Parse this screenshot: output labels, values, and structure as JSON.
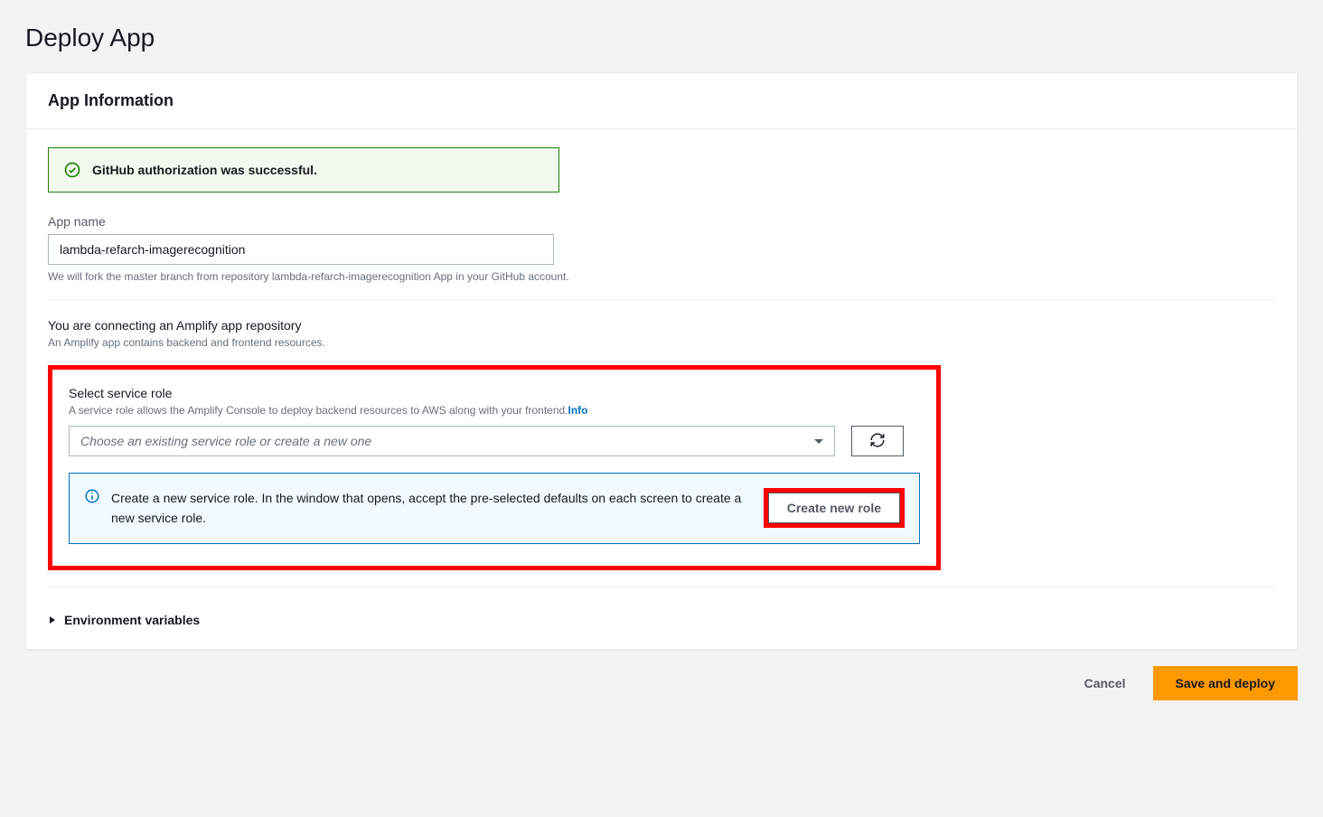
{
  "page": {
    "title": "Deploy App"
  },
  "card": {
    "title": "App Information"
  },
  "alert": {
    "message": "GitHub authorization was successful."
  },
  "appName": {
    "label": "App name",
    "value": "lambda-refarch-imagerecognition",
    "helper": "We will fork the master branch from repository lambda-refarch-imagerecognition App in your GitHub account."
  },
  "connecting": {
    "title": "You are connecting an Amplify app repository",
    "desc": "An Amplify app contains backend and frontend resources."
  },
  "serviceRole": {
    "label": "Select service role",
    "desc": "A service role allows the Amplify Console to deploy backend resources to AWS along with your frontend.",
    "infoLink": "Info",
    "placeholder": "Choose an existing service role or create a new one"
  },
  "infoBox": {
    "text": "Create a new service role. In the window that opens, accept the pre-selected defaults on each screen to create a new service role.",
    "button": "Create new role"
  },
  "env": {
    "label": "Environment variables"
  },
  "footer": {
    "cancel": "Cancel",
    "primary": "Save and deploy"
  }
}
